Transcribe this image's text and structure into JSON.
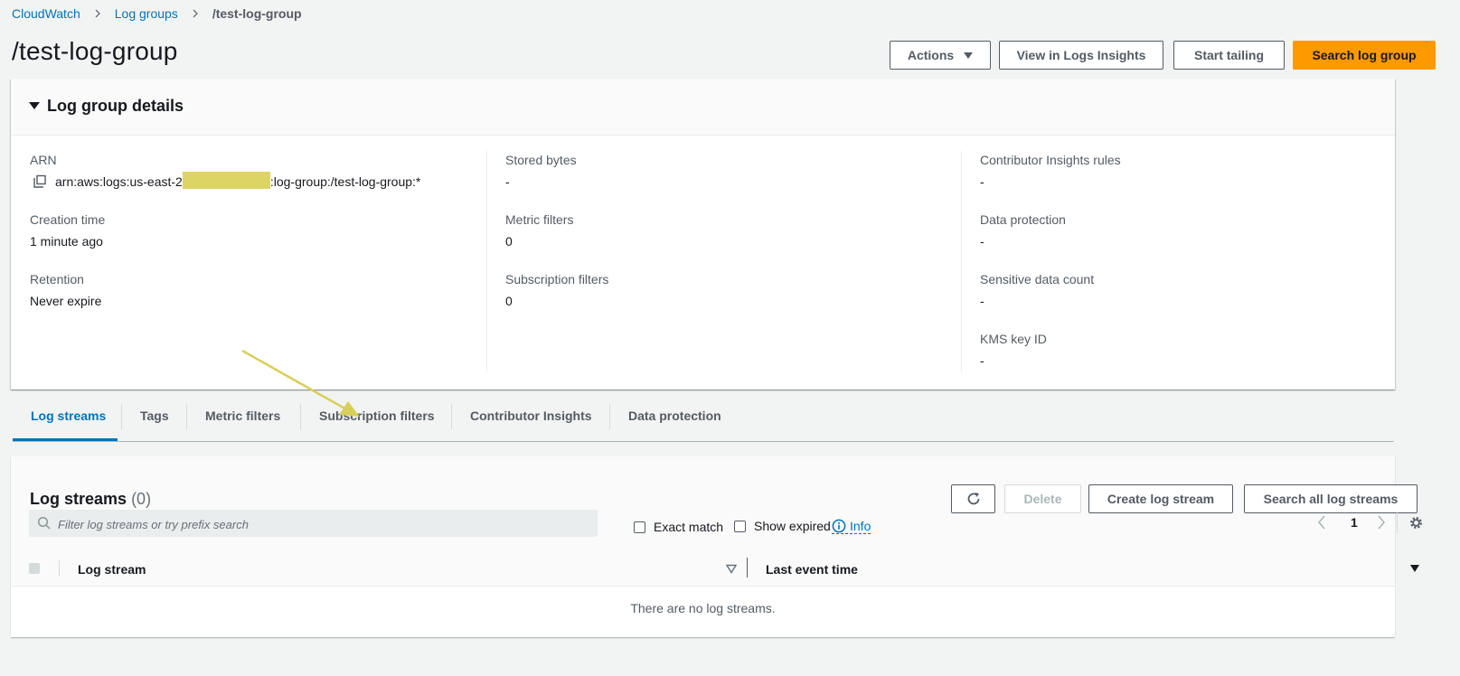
{
  "breadcrumb": {
    "items": [
      "CloudWatch",
      "Log groups"
    ],
    "current": "/test-log-group"
  },
  "page": {
    "title": "/test-log-group"
  },
  "header_actions": {
    "actions": "Actions",
    "view_insights": "View in Logs Insights",
    "start_tailing": "Start tailing",
    "search_group": "Search log group"
  },
  "details": {
    "title": "Log group details",
    "arn_label": "ARN",
    "arn_prefix": "arn:aws:logs:us-east-2",
    "arn_suffix": ":log-group:/test-log-group:*",
    "creation_label": "Creation time",
    "creation_value": "1 minute ago",
    "retention_label": "Retention",
    "retention_value": "Never expire",
    "stored_label": "Stored bytes",
    "stored_value": "-",
    "metric_label": "Metric filters",
    "metric_value": "0",
    "subscription_label": "Subscription filters",
    "subscription_value": "0",
    "contrib_label": "Contributor Insights rules",
    "contrib_value": "-",
    "dataprot_label": "Data protection",
    "dataprot_value": "-",
    "sensitive_label": "Sensitive data count",
    "sensitive_value": "-",
    "kms_label": "KMS key ID",
    "kms_value": "-"
  },
  "tabs": [
    "Log streams",
    "Tags",
    "Metric filters",
    "Subscription filters",
    "Contributor Insights",
    "Data protection"
  ],
  "streams": {
    "title": "Log streams",
    "count": "(0)",
    "delete": "Delete",
    "create": "Create log stream",
    "search_all": "Search all log streams",
    "search_placeholder": "Filter log streams or try prefix search",
    "exact_match": "Exact match",
    "show_expired": "Show expired",
    "info": "Info",
    "page_number": "1",
    "col_stream": "Log stream",
    "col_last_event": "Last event time",
    "empty": "There are no log streams."
  },
  "colors": {
    "accent": "#0073bb",
    "primary_button": "#ff9900",
    "annotation_arrow": "#d8cf5a",
    "redaction": "#ddd466"
  },
  "icons": [
    "chevron-right-icon",
    "caret-down-icon",
    "copy-icon",
    "refresh-icon",
    "search-icon",
    "info-icon",
    "chevron-left-icon",
    "gear-icon",
    "sort-icon"
  ]
}
